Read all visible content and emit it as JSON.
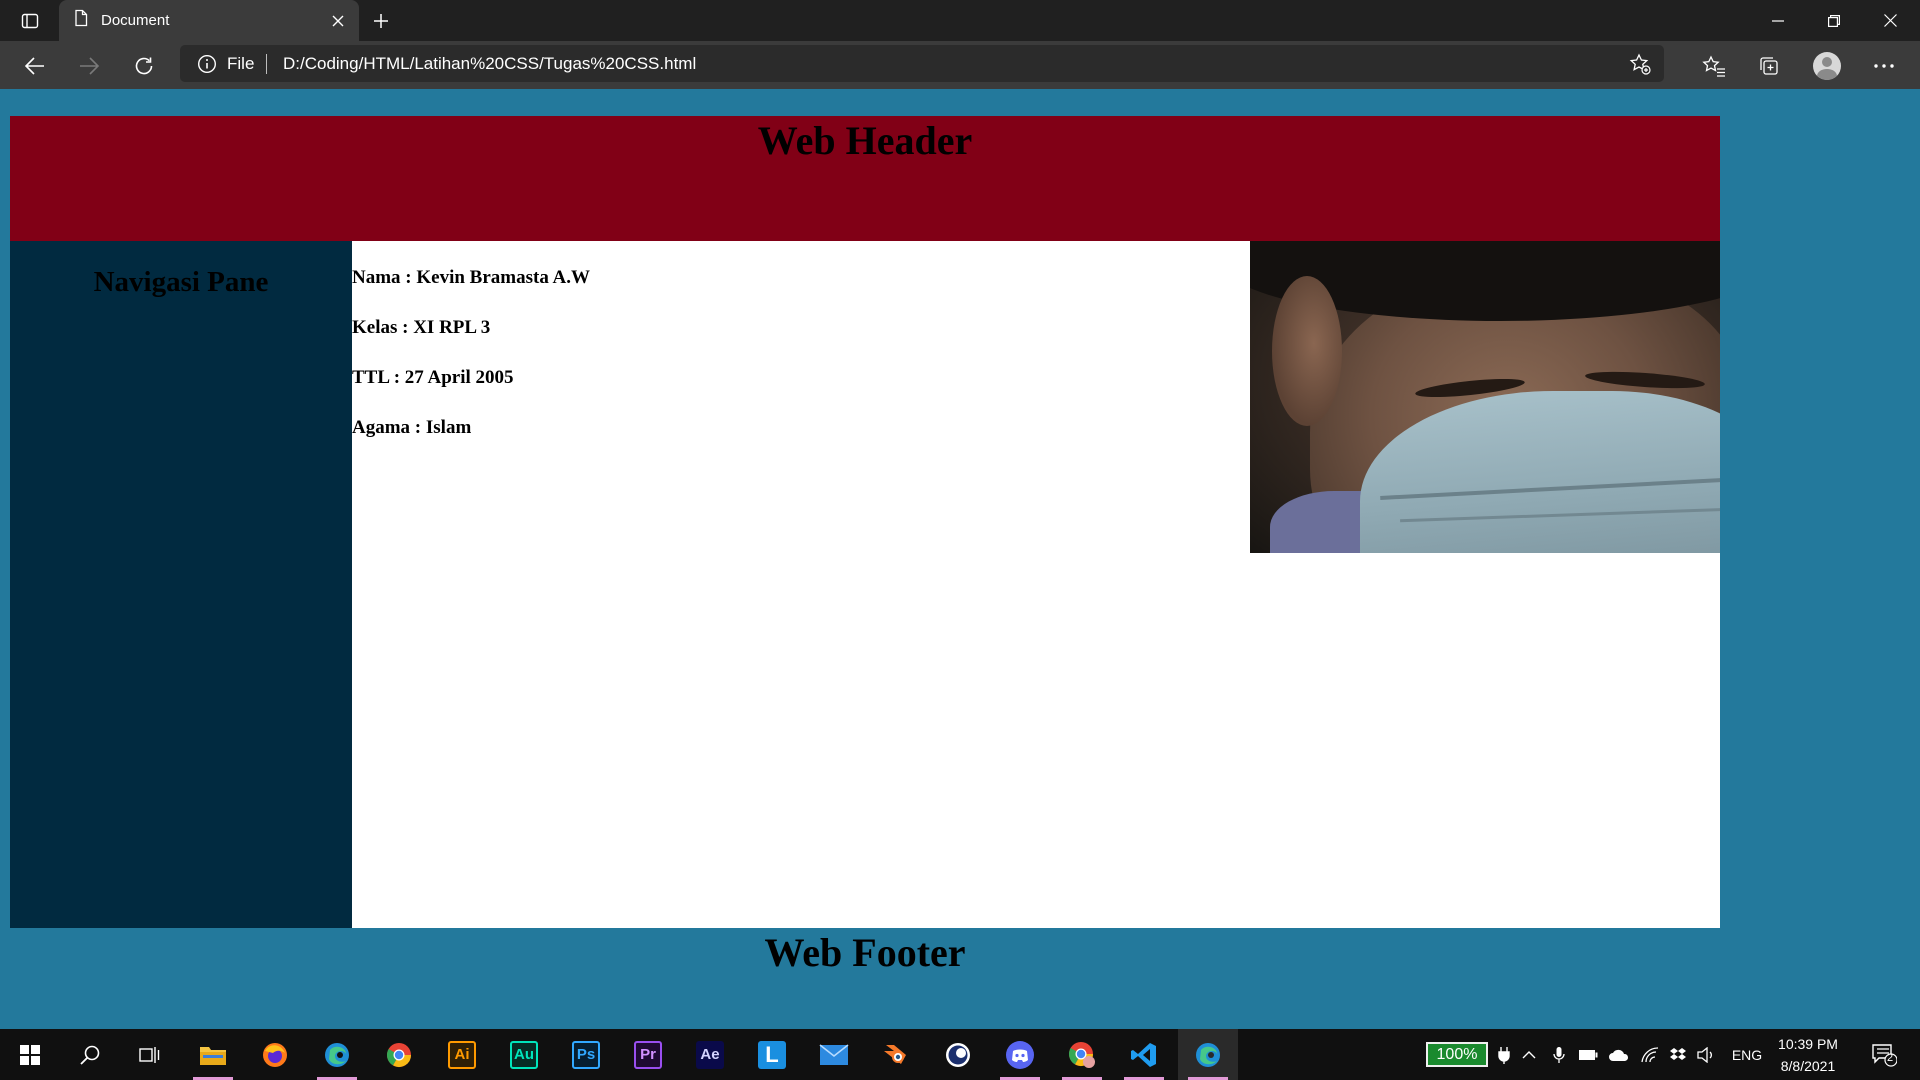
{
  "browser": {
    "tab": {
      "title": "Document"
    },
    "address": {
      "scheme": "File",
      "url": "D:/Coding/HTML/Latihan%20CSS/Tugas%20CSS.html"
    }
  },
  "page": {
    "header_title": "Web Header",
    "nav_title": "Navigasi Pane",
    "profile": [
      "Nama : Kevin Bramasta A.W",
      "Kelas : XI RPL 3",
      "TTL : 27 April 2005",
      "Agama : Islam"
    ],
    "footer_title": "Web Footer",
    "colors": {
      "page_background": "#23799c",
      "header": "#810016",
      "nav_pane": "#012a40",
      "content": "#ffffff"
    }
  },
  "taskbar": {
    "apps": [
      "start-icon",
      "search-icon",
      "task-view-icon",
      "file-explorer-icon",
      "firefox-icon",
      "edge-icon",
      "chrome-icon",
      "illustrator-icon",
      "audition-icon",
      "photoshop-icon",
      "premiere-icon",
      "after-effects-icon",
      "l-app-icon",
      "mail-icon",
      "blender-icon",
      "cinema4d-icon",
      "discord-icon",
      "chrome-profile-icon",
      "vscode-icon",
      "edge-active-icon"
    ],
    "app_labels": {
      "illustrator": "Ai",
      "audition": "Au",
      "photoshop": "Ps",
      "premiere": "Pr",
      "after_effects": "Ae",
      "l_app": "L"
    },
    "battery": "100%",
    "language": "ENG",
    "time": "10:39 PM",
    "date": "8/8/2021",
    "notifications": "2"
  }
}
